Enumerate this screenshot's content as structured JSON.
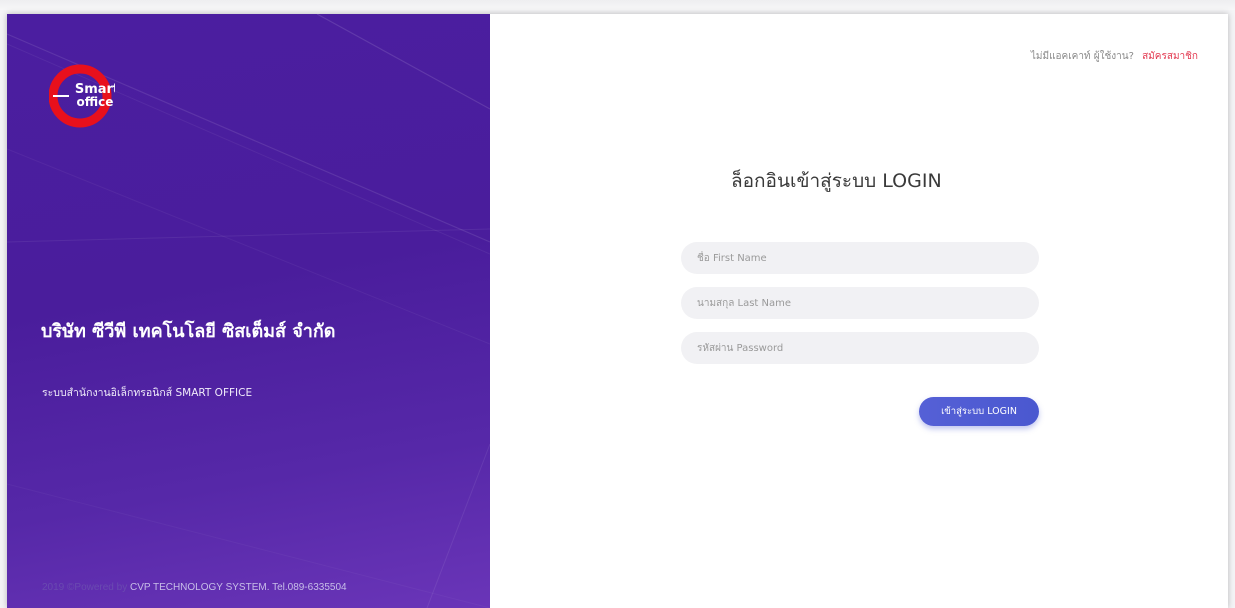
{
  "brand": {
    "logo_line1": "Smart",
    "logo_line2": "office",
    "logo_ring_color": "#e8101c"
  },
  "left": {
    "company_name": "บริษัท ซีวีพี เทคโนโลยี ซิสเต็มส์ จำกัด",
    "system_name": "ระบบสำนักงานอิเล็กทรอนิกส์ SMART OFFICE",
    "footer_prefix": "2019 ©Powered by",
    "footer_company": "CVP TECHNOLOGY SYSTEM. Tel.089-6335504",
    "bg_color": "#4b1ea0"
  },
  "right": {
    "no_account_text": "ไม่มีแอคเคาท์ ผู้ใช้งาน?",
    "register_link": "สมัครสมาชิก",
    "title": "ล็อกอินเข้าสู่ระบบ LOGIN",
    "first_name_placeholder": "ชื่อ First Name",
    "last_name_placeholder": "นามสกุล Last Name",
    "password_placeholder": "รหัสผ่าน Password",
    "login_button": "เข้าสู่ระบบ LOGIN",
    "accent_color": "#5560d6",
    "link_color": "#e33b52"
  }
}
